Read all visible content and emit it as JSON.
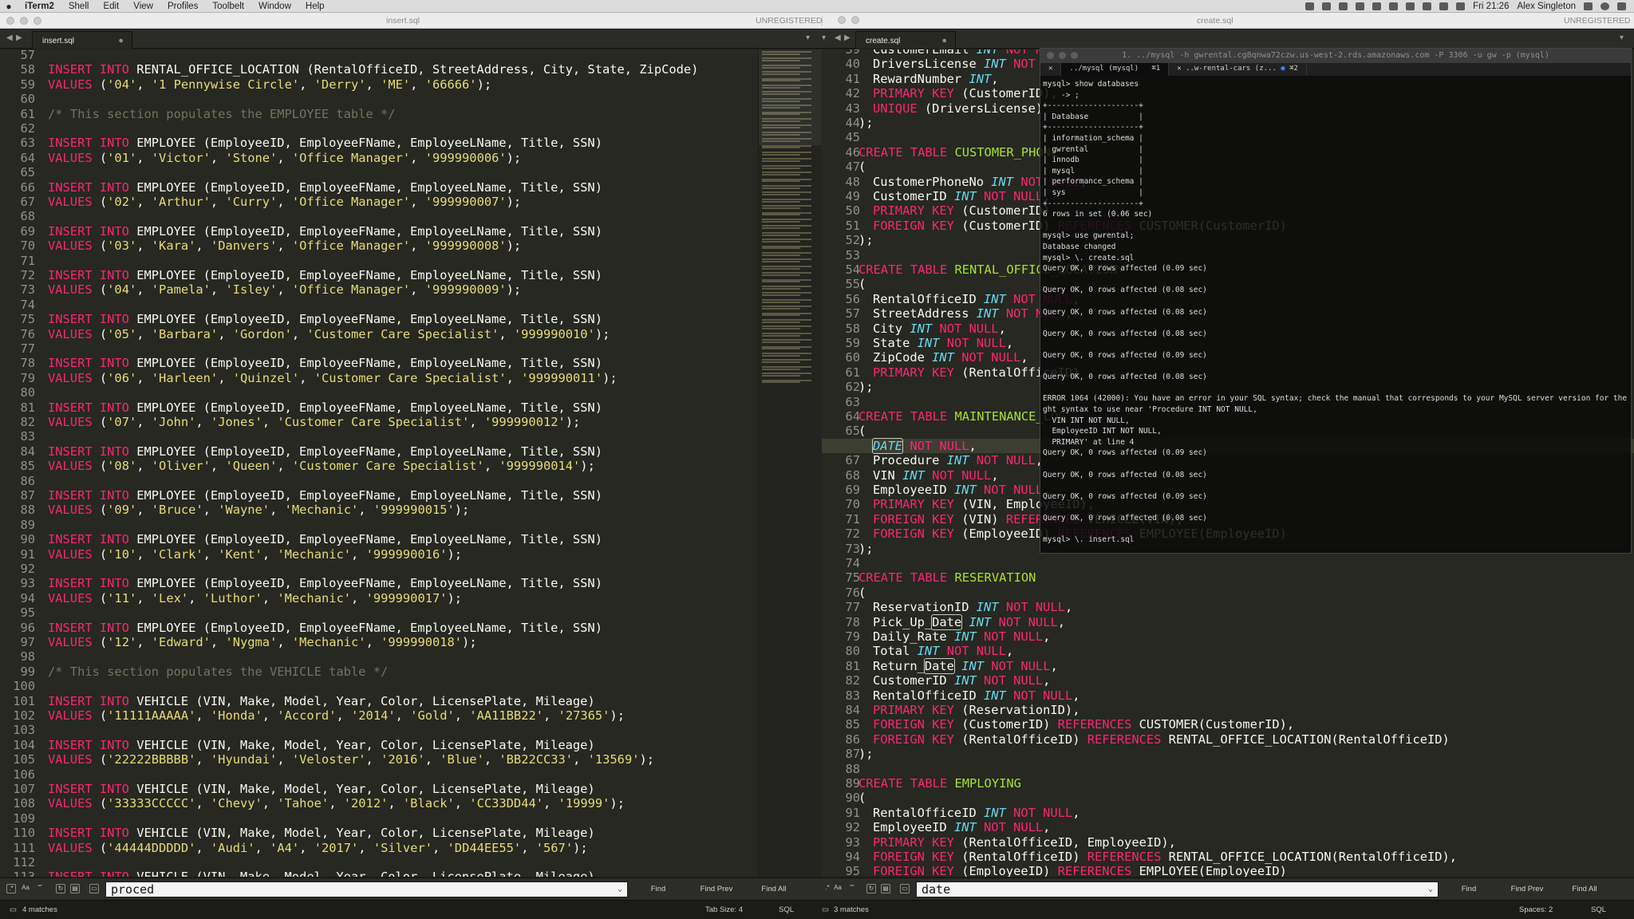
{
  "menubar": {
    "app": "iTerm2",
    "items": [
      "Shell",
      "Edit",
      "View",
      "Profiles",
      "Toolbelt",
      "Window",
      "Help"
    ],
    "clock": "Fri 21:26",
    "user": "Alex Singleton"
  },
  "titlebar": {
    "left_file": "insert.sql",
    "left_unregistered": "UNREGISTERED",
    "right_file": "create.sql",
    "right_unregistered": "UNREGISTERED"
  },
  "tabs": {
    "left": "insert.sql",
    "right": "create.sql"
  },
  "left_editor": {
    "lines": [
      {
        "n": "57",
        "code": ""
      },
      {
        "n": "58",
        "code": "INSERT INTO RENTAL_OFFICE_LOCATION (RentalOfficeID, StreetAddress, City, State, ZipCode)"
      },
      {
        "n": "59",
        "code": "VALUES ('04', '1 Pennywise Circle', 'Derry', 'ME', '66666');"
      },
      {
        "n": "60",
        "code": ""
      },
      {
        "n": "61",
        "code": "/* This section populates the EMPLOYEE table */"
      },
      {
        "n": "62",
        "code": ""
      },
      {
        "n": "63",
        "code": "INSERT INTO EMPLOYEE (EmployeeID, EmployeeFName, EmployeeLName, Title, SSN)"
      },
      {
        "n": "64",
        "code": "VALUES ('01', 'Victor', 'Stone', 'Office Manager', '999990006');"
      },
      {
        "n": "65",
        "code": ""
      },
      {
        "n": "66",
        "code": "INSERT INTO EMPLOYEE (EmployeeID, EmployeeFName, EmployeeLName, Title, SSN)"
      },
      {
        "n": "67",
        "code": "VALUES ('02', 'Arthur', 'Curry', 'Office Manager', '999990007');"
      },
      {
        "n": "68",
        "code": ""
      },
      {
        "n": "69",
        "code": "INSERT INTO EMPLOYEE (EmployeeID, EmployeeFName, EmployeeLName, Title, SSN)"
      },
      {
        "n": "70",
        "code": "VALUES ('03', 'Kara', 'Danvers', 'Office Manager', '999990008');"
      },
      {
        "n": "71",
        "code": ""
      },
      {
        "n": "72",
        "code": "INSERT INTO EMPLOYEE (EmployeeID, EmployeeFName, EmployeeLName, Title, SSN)"
      },
      {
        "n": "73",
        "code": "VALUES ('04', 'Pamela', 'Isley', 'Office Manager', '999990009');"
      },
      {
        "n": "74",
        "code": ""
      },
      {
        "n": "75",
        "code": "INSERT INTO EMPLOYEE (EmployeeID, EmployeeFName, EmployeeLName, Title, SSN)"
      },
      {
        "n": "76",
        "code": "VALUES ('05', 'Barbara', 'Gordon', 'Customer Care Specialist', '999990010');"
      },
      {
        "n": "77",
        "code": ""
      },
      {
        "n": "78",
        "code": "INSERT INTO EMPLOYEE (EmployeeID, EmployeeFName, EmployeeLName, Title, SSN)"
      },
      {
        "n": "79",
        "code": "VALUES ('06', 'Harleen', 'Quinzel', 'Customer Care Specialist', '999990011');"
      },
      {
        "n": "80",
        "code": ""
      },
      {
        "n": "81",
        "code": "INSERT INTO EMPLOYEE (EmployeeID, EmployeeFName, EmployeeLName, Title, SSN)"
      },
      {
        "n": "82",
        "code": "VALUES ('07', 'John', 'Jones', 'Customer Care Specialist', '999990012');"
      },
      {
        "n": "83",
        "code": ""
      },
      {
        "n": "84",
        "code": "INSERT INTO EMPLOYEE (EmployeeID, EmployeeFName, EmployeeLName, Title, SSN)"
      },
      {
        "n": "85",
        "code": "VALUES ('08', 'Oliver', 'Queen', 'Customer Care Specialist', '999990014');"
      },
      {
        "n": "86",
        "code": ""
      },
      {
        "n": "87",
        "code": "INSERT INTO EMPLOYEE (EmployeeID, EmployeeFName, EmployeeLName, Title, SSN)"
      },
      {
        "n": "88",
        "code": "VALUES ('09', 'Bruce', 'Wayne', 'Mechanic', '999990015');"
      },
      {
        "n": "89",
        "code": ""
      },
      {
        "n": "90",
        "code": "INSERT INTO EMPLOYEE (EmployeeID, EmployeeFName, EmployeeLName, Title, SSN)"
      },
      {
        "n": "91",
        "code": "VALUES ('10', 'Clark', 'Kent', 'Mechanic', '999990016');"
      },
      {
        "n": "92",
        "code": ""
      },
      {
        "n": "93",
        "code": "INSERT INTO EMPLOYEE (EmployeeID, EmployeeFName, EmployeeLName, Title, SSN)"
      },
      {
        "n": "94",
        "code": "VALUES ('11', 'Lex', 'Luthor', 'Mechanic', '999990017');"
      },
      {
        "n": "95",
        "code": ""
      },
      {
        "n": "96",
        "code": "INSERT INTO EMPLOYEE (EmployeeID, EmployeeFName, EmployeeLName, Title, SSN)"
      },
      {
        "n": "97",
        "code": "VALUES ('12', 'Edward', 'Nygma', 'Mechanic', '999990018');"
      },
      {
        "n": "98",
        "code": ""
      },
      {
        "n": "99",
        "code": "/* This section populates the VEHICLE table */"
      },
      {
        "n": "100",
        "code": ""
      },
      {
        "n": "101",
        "code": "INSERT INTO VEHICLE (VIN, Make, Model, Year, Color, LicensePlate, Mileage)"
      },
      {
        "n": "102",
        "code": "VALUES ('11111AAAAA', 'Honda', 'Accord', '2014', 'Gold', 'AA11BB22', '27365');"
      },
      {
        "n": "103",
        "code": ""
      },
      {
        "n": "104",
        "code": "INSERT INTO VEHICLE (VIN, Make, Model, Year, Color, LicensePlate, Mileage)"
      },
      {
        "n": "105",
        "code": "VALUES ('22222BBBBB', 'Hyundai', 'Veloster', '2016', 'Blue', 'BB22CC33', '13569');"
      },
      {
        "n": "106",
        "code": ""
      },
      {
        "n": "107",
        "code": "INSERT INTO VEHICLE (VIN, Make, Model, Year, Color, LicensePlate, Mileage)"
      },
      {
        "n": "108",
        "code": "VALUES ('33333CCCCC', 'Chevy', 'Tahoe', '2012', 'Black', 'CC33DD44', '19999');"
      },
      {
        "n": "109",
        "code": ""
      },
      {
        "n": "110",
        "code": "INSERT INTO VEHICLE (VIN, Make, Model, Year, Color, LicensePlate, Mileage)"
      },
      {
        "n": "111",
        "code": "VALUES ('44444DDDDD', 'Audi', 'A4', '2017', 'Silver', 'DD44EE55', '567');"
      },
      {
        "n": "112",
        "code": ""
      },
      {
        "n": "113",
        "code": "INSERT INTO VEHICLE (VIN, Make, Model, Year, Color, LicensePlate, Mileage)"
      }
    ]
  },
  "right_editor": {
    "current_line": "66",
    "lines": [
      {
        "n": "39",
        "code": "CustomerEmail INT NOT NULL,"
      },
      {
        "n": "40",
        "code": "DriversLicense INT NOT NULL,"
      },
      {
        "n": "41",
        "code": "RewardNumber INT,"
      },
      {
        "n": "42",
        "code": "PRIMARY KEY (CustomerID),"
      },
      {
        "n": "43",
        "code": "UNIQUE (DriversLicense)"
      },
      {
        "n": "44",
        "code": ");"
      },
      {
        "n": "45",
        "code": ""
      },
      {
        "n": "46",
        "code": "CREATE TABLE CUSTOMER_PHONE"
      },
      {
        "n": "47",
        "code": "("
      },
      {
        "n": "48",
        "code": "CustomerPhoneNo INT NOT NULL,"
      },
      {
        "n": "49",
        "code": "CustomerID INT NOT NULL,"
      },
      {
        "n": "50",
        "code": "PRIMARY KEY (CustomerID),"
      },
      {
        "n": "51",
        "code": "FOREIGN KEY (CustomerID) REFERENCES CUSTOMER(CustomerID)"
      },
      {
        "n": "52",
        "code": ");"
      },
      {
        "n": "53",
        "code": ""
      },
      {
        "n": "54",
        "code": "CREATE TABLE RENTAL_OFFICE_LOCATION"
      },
      {
        "n": "55",
        "code": "("
      },
      {
        "n": "56",
        "code": "RentalOfficeID INT NOT NULL,"
      },
      {
        "n": "57",
        "code": "StreetAddress INT NOT NULL,"
      },
      {
        "n": "58",
        "code": "City INT NOT NULL,"
      },
      {
        "n": "59",
        "code": "State INT NOT NULL,"
      },
      {
        "n": "60",
        "code": "ZipCode INT NOT NULL,"
      },
      {
        "n": "61",
        "code": "PRIMARY KEY (RentalOfficeID)"
      },
      {
        "n": "62",
        "code": ");"
      },
      {
        "n": "63",
        "code": ""
      },
      {
        "n": "64",
        "code": "CREATE TABLE MAINTENANCE_LOG"
      },
      {
        "n": "65",
        "code": "("
      },
      {
        "n": "66",
        "code": "DATE NOT NULL,"
      },
      {
        "n": "67",
        "code": "Procedure INT NOT NULL,"
      },
      {
        "n": "68",
        "code": "VIN INT NOT NULL,"
      },
      {
        "n": "69",
        "code": "EmployeeID INT NOT NULL,"
      },
      {
        "n": "70",
        "code": "PRIMARY KEY (VIN, EmployeeID),"
      },
      {
        "n": "71",
        "code": "FOREIGN KEY (VIN) REFERENCES VEHICLE(VIN),"
      },
      {
        "n": "72",
        "code": "FOREIGN KEY (EmployeeID) REFERENCES EMPLOYEE(EmployeeID)"
      },
      {
        "n": "73",
        "code": ");"
      },
      {
        "n": "74",
        "code": ""
      },
      {
        "n": "75",
        "code": "CREATE TABLE RESERVATION"
      },
      {
        "n": "76",
        "code": "("
      },
      {
        "n": "77",
        "code": "ReservationID INT NOT NULL,"
      },
      {
        "n": "78",
        "code": "Pick_Up_Date INT NOT NULL,"
      },
      {
        "n": "79",
        "code": "Daily_Rate INT NOT NULL,"
      },
      {
        "n": "80",
        "code": "Total INT NOT NULL,"
      },
      {
        "n": "81",
        "code": "Return_Date INT NOT NULL,"
      },
      {
        "n": "82",
        "code": "CustomerID INT NOT NULL,"
      },
      {
        "n": "83",
        "code": "RentalOfficeID INT NOT NULL,"
      },
      {
        "n": "84",
        "code": "PRIMARY KEY (ReservationID),"
      },
      {
        "n": "85",
        "code": "FOREIGN KEY (CustomerID) REFERENCES CUSTOMER(CustomerID),"
      },
      {
        "n": "86",
        "code": "FOREIGN KEY (RentalOfficeID) REFERENCES RENTAL_OFFICE_LOCATION(RentalOfficeID)"
      },
      {
        "n": "87",
        "code": ");"
      },
      {
        "n": "88",
        "code": ""
      },
      {
        "n": "89",
        "code": "CREATE TABLE EMPLOYING"
      },
      {
        "n": "90",
        "code": "("
      },
      {
        "n": "91",
        "code": "RentalOfficeID INT NOT NULL,"
      },
      {
        "n": "92",
        "code": "EmployeeID INT NOT NULL,"
      },
      {
        "n": "93",
        "code": "PRIMARY KEY (RentalOfficeID, EmployeeID),"
      },
      {
        "n": "94",
        "code": "FOREIGN KEY (RentalOfficeID) REFERENCES RENTAL_OFFICE_LOCATION(RentalOfficeID),"
      },
      {
        "n": "95",
        "code": "FOREIGN KEY (EmployeeID) REFERENCES EMPLOYEE(EmployeeID)"
      }
    ]
  },
  "terminal": {
    "title": "1. ../mysql -h gwrental.cg8qnwa72czw.us-west-2.rds.amazonaws.com -P 3306 -u gw -p (mysql)",
    "tab1": "../mysql (mysql)",
    "tab1_shortcut": "⌘1",
    "tab2": "..w-rental-cars (z...",
    "tab2_shortcut": "⌘2",
    "lines": [
      "mysql> show databases",
      "    -> ;",
      "+--------------------+",
      "| Database           |",
      "+--------------------+",
      "| information_schema |",
      "| gwrental           |",
      "| innodb             |",
      "| mysql              |",
      "| performance_schema |",
      "| sys                |",
      "+--------------------+",
      "6 rows in set (0.06 sec)",
      "",
      "mysql> use gwrental;",
      "Database changed",
      "mysql> \\. create.sql",
      "Query OK, 0 rows affected (0.09 sec)",
      "",
      "Query OK, 0 rows affected (0.08 sec)",
      "",
      "Query OK, 0 rows affected (0.08 sec)",
      "",
      "Query OK, 0 rows affected (0.08 sec)",
      "",
      "Query OK, 0 rows affected (0.09 sec)",
      "",
      "Query OK, 0 rows affected (0.08 sec)",
      "",
      "ERROR 1064 (42000): You have an error in your SQL syntax; check the manual that corresponds to your MySQL server version for the ri",
      "ght syntax to use near 'Procedure INT NOT NULL,",
      "  VIN INT NOT NULL,",
      "  EmployeeID INT NOT NULL,",
      "  PRIMARY' at line 4",
      "Query OK, 0 rows affected (0.09 sec)",
      "",
      "Query OK, 0 rows affected (0.08 sec)",
      "",
      "Query OK, 0 rows affected (0.09 sec)",
      "",
      "Query OK, 0 rows affected (0.08 sec)",
      "",
      "mysql> \\. insert.sql"
    ]
  },
  "find_left": {
    "query": "proced",
    "find": "Find",
    "find_prev": "Find Prev",
    "find_all": "Find All",
    "opt_aa": "Aa",
    "opt_quote": "“”"
  },
  "find_right": {
    "query": "date",
    "find": "Find",
    "find_prev": "Find Prev",
    "find_all": "Find All",
    "opt_aa": "Aa",
    "opt_quote": "“”"
  },
  "status": {
    "left_matches": "4 matches",
    "tab_size": "Tab Size: 4",
    "left_syntax": "SQL",
    "right_matches": "3 matches",
    "spaces": "Spaces: 2",
    "right_syntax": "SQL"
  }
}
